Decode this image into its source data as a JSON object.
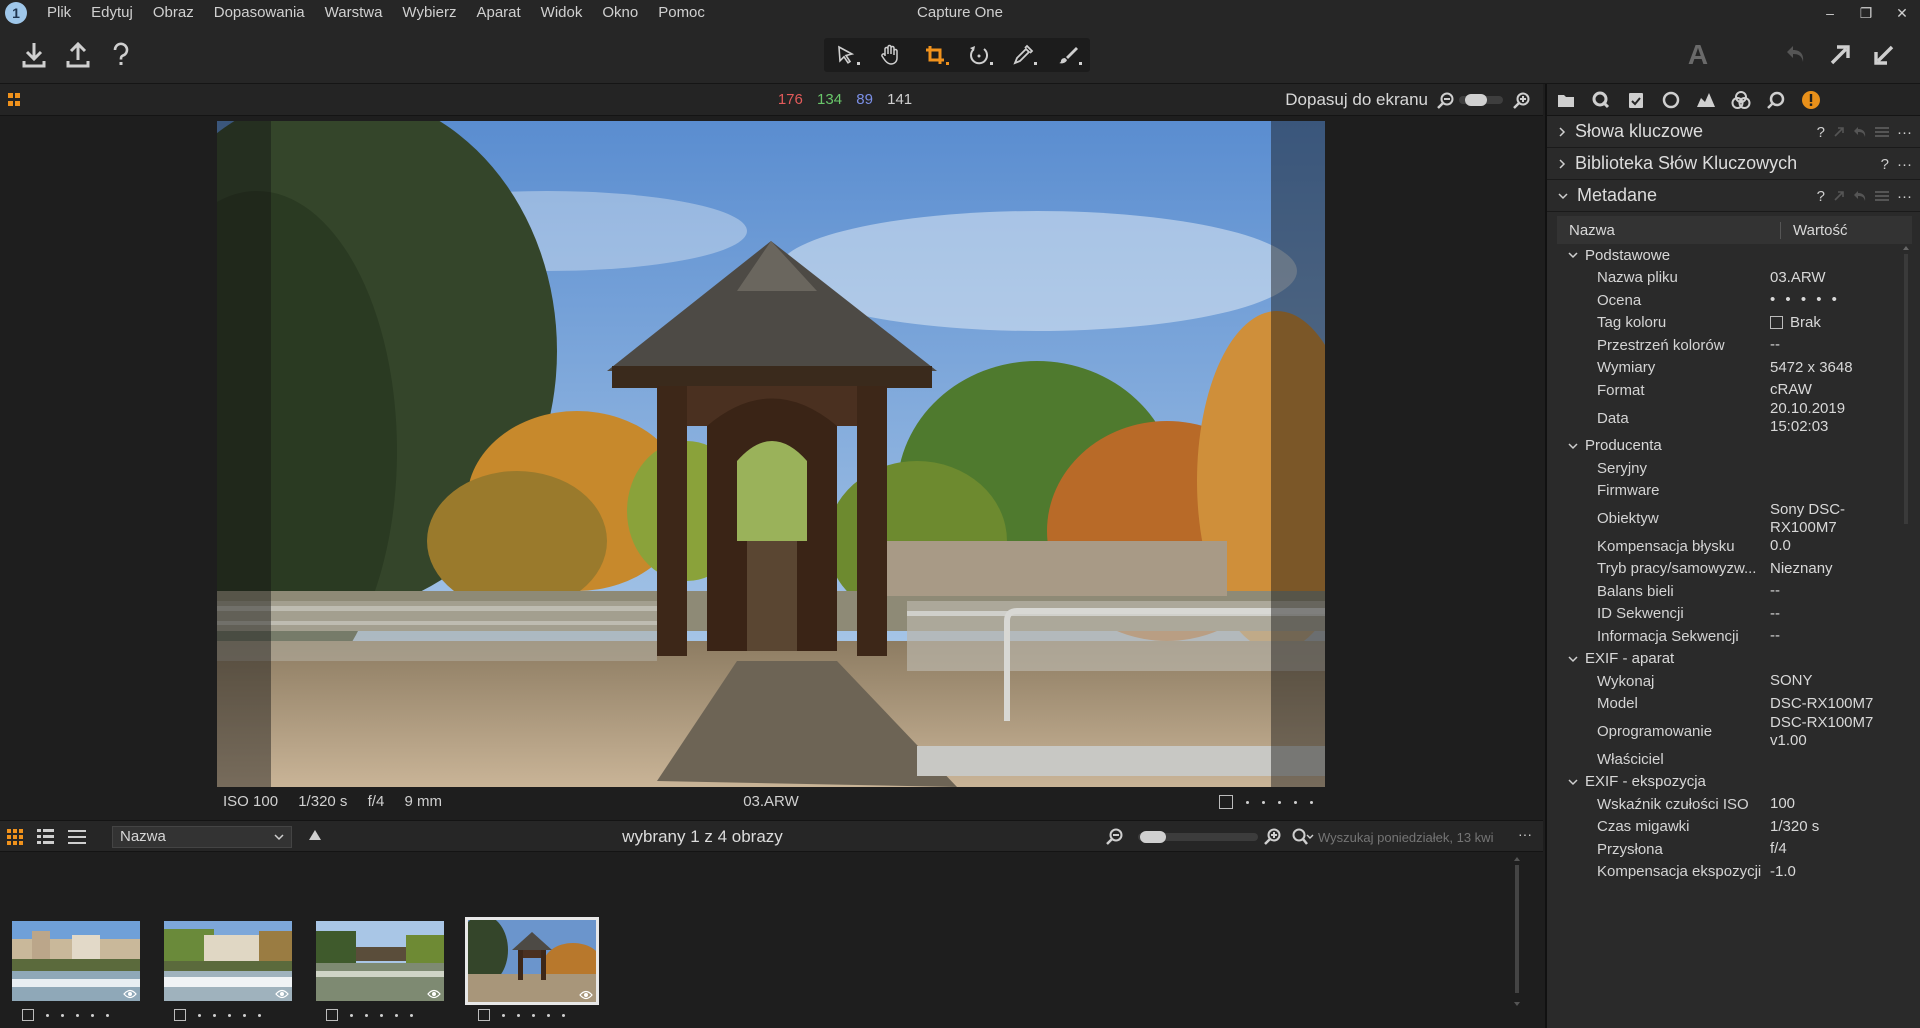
{
  "app": {
    "title": "Capture One",
    "icon_glyph": "1"
  },
  "menu": [
    "Plik",
    "Edytuj",
    "Obraz",
    "Dopasowania",
    "Warstwa",
    "Wybierz",
    "Aparat",
    "Widok",
    "Okno",
    "Pomoc"
  ],
  "window_controls": {
    "minimize": "–",
    "maximize": "❐",
    "close": "✕"
  },
  "toolbar": {
    "left_icons": [
      "import-icon",
      "export-icon",
      "help-icon"
    ],
    "tools": [
      "select-cursor-icon",
      "pan-hand-icon",
      "crop-icon",
      "rotate-icon",
      "picker-icon",
      "brush-icon"
    ],
    "active_tool": "crop-icon",
    "right_icons": [
      "text-icon",
      "undo-icon",
      "process-icon",
      "sync-icon"
    ],
    "text_glyph": "A"
  },
  "viewer": {
    "rgb": {
      "r": "176",
      "g": "134",
      "b": "89",
      "l": "141"
    },
    "zoom_label": "Dopasuj do ekranu",
    "exif": {
      "iso": "ISO 100",
      "shutter": "1/320 s",
      "aperture": "f/4",
      "focal": "9 mm"
    },
    "filename": "03.ARW",
    "rating_dots": 5
  },
  "browser": {
    "sort": "Nazwa",
    "count_text": "wybrany 1 z 4 obrazy",
    "search_placeholder": "Wyszukaj poniedziałek, 13 kwi",
    "more": "···",
    "thumbnails": [
      {
        "name": "thumb-1",
        "selected": false,
        "rating_dots": 5
      },
      {
        "name": "thumb-2",
        "selected": false,
        "rating_dots": 5
      },
      {
        "name": "thumb-3",
        "selected": false,
        "rating_dots": 5
      },
      {
        "name": "thumb-4",
        "selected": true,
        "rating_dots": 5
      }
    ]
  },
  "panel": {
    "tabs": [
      "folder-icon",
      "quick-icon",
      "checklist-icon",
      "circle-icon",
      "chart-icon",
      "color-icon",
      "search-icon",
      "info-icon"
    ],
    "active_tab": "info-icon",
    "accent": "#e8901a",
    "sections": [
      {
        "title": "Słowa kluczowe",
        "expanded": false
      },
      {
        "title": "Biblioteka Słów Kluczowych",
        "expanded": false
      },
      {
        "title": "Metadane",
        "expanded": true
      }
    ],
    "metadata": {
      "col_name": "Nazwa",
      "col_value": "Wartość",
      "groups": [
        {
          "title": "Podstawowe",
          "rows": [
            {
              "label": "Nazwa pliku",
              "value": "03.ARW"
            },
            {
              "label": "Ocena",
              "value": "• • • • •"
            },
            {
              "label": "Tag koloru",
              "value": "Brak"
            },
            {
              "label": "Przestrzeń kolorów",
              "value": "--"
            },
            {
              "label": "Wymiary",
              "value": "5472 x 3648"
            },
            {
              "label": "Format",
              "value": "cRAW"
            },
            {
              "label": "Data",
              "value": "20.10.2019\n15:02:03"
            }
          ]
        },
        {
          "title": "Producenta",
          "rows": [
            {
              "label": "Seryjny",
              "value": ""
            },
            {
              "label": "Firmware",
              "value": ""
            },
            {
              "label": "Obiektyw",
              "value": "Sony DSC-\nRX100M7"
            },
            {
              "label": "Kompensacja błysku",
              "value": "0.0"
            },
            {
              "label": "Tryb pracy/samowyzw...",
              "value": "Nieznany"
            },
            {
              "label": "Balans bieli",
              "value": "--"
            },
            {
              "label": "ID Sekwencji",
              "value": "--"
            },
            {
              "label": "Informacja Sekwencji",
              "value": "--"
            }
          ]
        },
        {
          "title": "EXIF - aparat",
          "rows": [
            {
              "label": "Wykonaj",
              "value": "SONY"
            },
            {
              "label": "Model",
              "value": "DSC-RX100M7"
            },
            {
              "label": "Oprogramowanie",
              "value": "DSC-RX100M7\nv1.00"
            },
            {
              "label": "Właściciel",
              "value": ""
            }
          ]
        },
        {
          "title": "EXIF - ekspozycja",
          "rows": [
            {
              "label": "Wskaźnik czułości ISO",
              "value": "100"
            },
            {
              "label": "Czas migawki",
              "value": "1/320 s"
            },
            {
              "label": "Przysłona",
              "value": "f/4"
            },
            {
              "label": "Kompensacja ekspozycji",
              "value": "-1.0"
            }
          ]
        }
      ]
    }
  }
}
